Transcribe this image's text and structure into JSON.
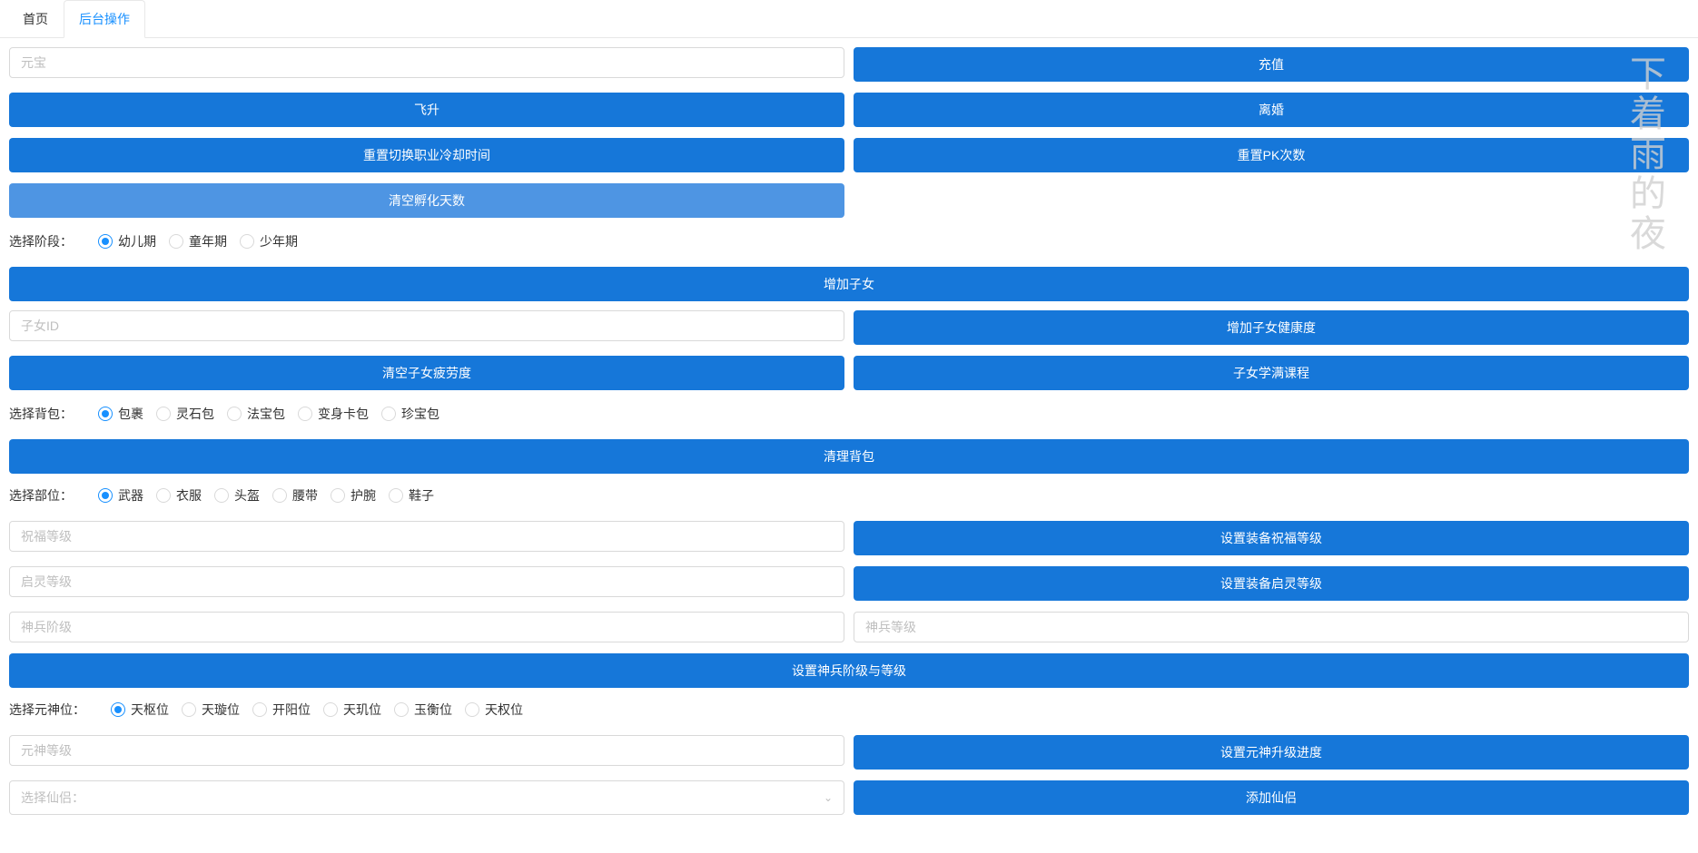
{
  "tabs": {
    "home": "首页",
    "backend": "后台操作"
  },
  "watermark": "下着雨的夜",
  "inputs": {
    "yuanbao": "元宝",
    "child_id": "子女ID",
    "bless_level": "祝福等级",
    "enlighten_level": "启灵等级",
    "weapon_rank": "神兵阶级",
    "weapon_level": "神兵等级",
    "spirit_level": "元神等级",
    "select_partner": "选择仙侣："
  },
  "buttons": {
    "recharge": "充值",
    "ascend": "飞升",
    "divorce": "离婚",
    "reset_job_cooldown": "重置切换职业冷却时间",
    "reset_pk": "重置PK次数",
    "clear_incubation": "清空孵化天数",
    "add_child": "增加子女",
    "add_child_health": "增加子女健康度",
    "clear_child_fatigue": "清空子女疲劳度",
    "child_full_lesson": "子女学满课程",
    "clear_bag": "清理背包",
    "set_bless_level": "设置装备祝福等级",
    "set_enlighten_level": "设置装备启灵等级",
    "set_weapon_rank": "设置神兵阶级与等级",
    "set_spirit_progress": "设置元神升级进度",
    "add_partner": "添加仙侣"
  },
  "radios": {
    "stage": {
      "label": "选择阶段：",
      "options": [
        "幼儿期",
        "童年期",
        "少年期"
      ],
      "selected": 0
    },
    "bag": {
      "label": "选择背包：",
      "options": [
        "包裹",
        "灵石包",
        "法宝包",
        "变身卡包",
        "珍宝包"
      ],
      "selected": 0
    },
    "part": {
      "label": "选择部位：",
      "options": [
        "武器",
        "衣服",
        "头盔",
        "腰带",
        "护腕",
        "鞋子"
      ],
      "selected": 0
    },
    "spirit": {
      "label": "选择元神位：",
      "options": [
        "天枢位",
        "天璇位",
        "开阳位",
        "天玑位",
        "玉衡位",
        "天权位"
      ],
      "selected": 0
    }
  }
}
